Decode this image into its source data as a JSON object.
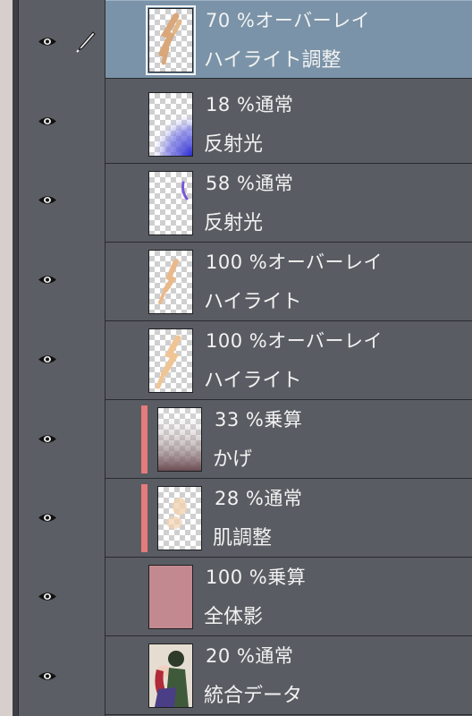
{
  "layers": [
    {
      "mode": "70 %オーバーレイ",
      "name": "ハイライト調整",
      "selected": true,
      "thumb": "highlight-strokes"
    },
    {
      "mode": "18 %通常",
      "name": "反射光",
      "thumb": "blue-glow"
    },
    {
      "mode": "58 %通常",
      "name": "反射光",
      "thumb": "purple-mark"
    },
    {
      "mode": "100 %オーバーレイ",
      "name": "ハイライト",
      "thumb": "highlight-strokes"
    },
    {
      "mode": "100 %オーバーレイ",
      "name": "ハイライト",
      "thumb": "highlight-strokes"
    },
    {
      "mode": "33 %乗算",
      "name": "かげ",
      "clipped": true,
      "thumb": "shadow-gradient"
    },
    {
      "mode": "28 %通常",
      "name": "肌調整",
      "clipped": true,
      "thumb": "skin-blobs"
    },
    {
      "mode": "100 %乗算",
      "name": "全体影",
      "thumb": "solid-pink"
    },
    {
      "mode": "20 %通常",
      "name": "統合データ",
      "thumb": "character-art"
    }
  ],
  "colors": {
    "selected_row": "#7a93a8",
    "clip_bar": "#e57b7b",
    "panel": "#5a5c63"
  },
  "icons": {
    "visibility": "eye-icon",
    "edit": "pen-icon"
  }
}
